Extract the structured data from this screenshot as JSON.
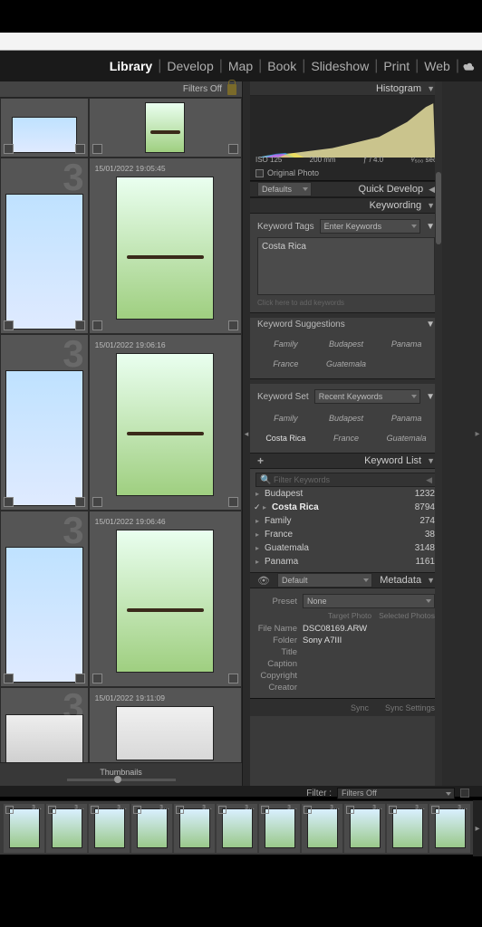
{
  "modules": {
    "items": [
      "Library",
      "Develop",
      "Map",
      "Book",
      "Slideshow",
      "Print",
      "Web"
    ],
    "active": "Library"
  },
  "grid": {
    "filters_label": "Filters Off",
    "thumbnails_label": "Thumbnails",
    "cells": [
      {
        "ts": "",
        "kind": "small"
      },
      {
        "ts": "",
        "kind": "small-wide"
      },
      {
        "ts": "15/01/2022 19:05:45",
        "kind": "tall"
      },
      {
        "ts": "15/01/2022 19:06:16",
        "kind": "tall"
      },
      {
        "ts": "15/01/2022 19:06:46",
        "kind": "tall"
      },
      {
        "ts": "15/01/2022 19:11:09",
        "kind": "tall"
      }
    ]
  },
  "panels": {
    "histogram": {
      "title": "Histogram",
      "iso": "ISO 125",
      "focal": "200 mm",
      "aperture": "ƒ / 4.0",
      "shutter": "¹⁄₅₀₀ sec",
      "original": "Original Photo"
    },
    "quick_develop": {
      "title": "Quick Develop",
      "preset_label": "Defaults"
    },
    "keywording": {
      "title": "Keywording",
      "tags_label": "Keyword Tags",
      "enter_placeholder": "Enter Keywords",
      "tags_value": "Costa Rica",
      "hint": "Click here to add keywords",
      "suggestions_label": "Keyword Suggestions",
      "suggestions": [
        "Family",
        "Budapest",
        "Panama",
        "France",
        "Guatemala",
        ""
      ],
      "set_label": "Keyword Set",
      "set_value": "Recent Keywords",
      "set_items": [
        "Family",
        "Budapest",
        "Panama",
        "Costa Rica",
        "France",
        "Guatemala"
      ]
    },
    "keyword_list": {
      "title": "Keyword List",
      "search_placeholder": "Filter Keywords",
      "items": [
        {
          "name": "Budapest",
          "count": 1232,
          "checked": false
        },
        {
          "name": "Costa Rica",
          "count": 8794,
          "checked": true
        },
        {
          "name": "Family",
          "count": 274,
          "checked": false
        },
        {
          "name": "France",
          "count": 38,
          "checked": false
        },
        {
          "name": "Guatemala",
          "count": 3148,
          "checked": false
        },
        {
          "name": "Panama",
          "count": 1161,
          "checked": false
        }
      ]
    },
    "metadata": {
      "title": "Metadata",
      "view": "Default",
      "preset_label": "Preset",
      "preset_value": "None",
      "target_btn": "Target Photo",
      "selected_btn": "Selected Photos",
      "rows": {
        "file_name_l": "File Name",
        "file_name_v": "DSC08169.ARW",
        "folder_l": "Folder",
        "folder_v": "Sony A7III",
        "title_l": "Title",
        "title_v": "",
        "caption_l": "Caption",
        "caption_v": "",
        "copyright_l": "Copyright",
        "copyright_v": "",
        "creator_l": "Creator",
        "creator_v": ""
      },
      "sync": "Sync",
      "sync_settings": "Sync Settings"
    }
  },
  "filter_bar": {
    "label": "Filter :",
    "value": "Filters Off"
  },
  "filmstrip_count": 11
}
